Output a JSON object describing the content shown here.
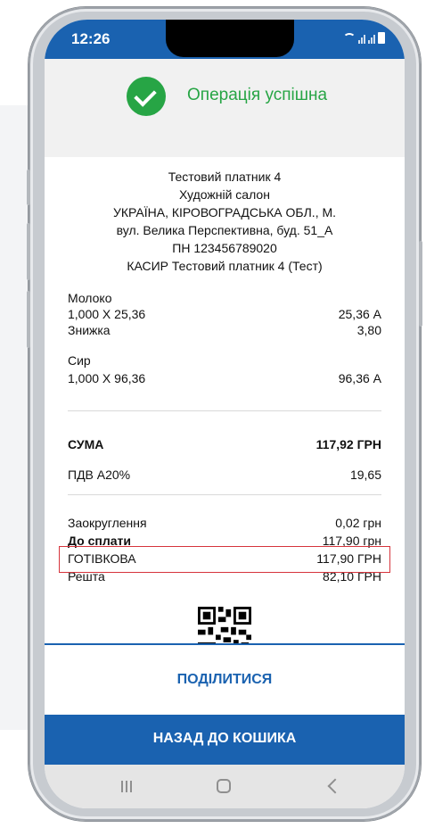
{
  "status_bar": {
    "time": "12:26"
  },
  "success": {
    "message": "Операція успішна"
  },
  "receipt": {
    "header": [
      "Тестовий платник 4",
      "Художній салон",
      "УКРАЇНА, КІРОВОГРАДСЬКА ОБЛ., М.",
      "вул. Велика Перспективна, буд. 51_А",
      "ПН 123456789020",
      "КАСИР Тестовий платник 4 (Тест)"
    ],
    "items": [
      {
        "name": "Молоко",
        "qty_line": "1,000 X 25,36",
        "amount": "25,36 А",
        "discount_label": "Знижка",
        "discount": "3,80"
      },
      {
        "name": "Сир",
        "qty_line": "1,000 X 96,36",
        "amount": "96,36 А"
      }
    ],
    "sum": {
      "label": "СУМА",
      "value": "117,92 ГРН"
    },
    "vat": {
      "label": "ПДВ А20%",
      "value": "19,65"
    },
    "rounding": {
      "label": "Заокруглення",
      "value": "0,02 грн"
    },
    "to_pay": {
      "label": "До сплати",
      "value": "117,90 грн"
    },
    "cash": {
      "label": "ГОТІВКОВА",
      "value": "117,90 ГРН"
    },
    "change": {
      "label": "Решта",
      "value": "82,10 ГРН"
    }
  },
  "actions": {
    "share_label": "ПОДІЛИТИСЯ",
    "back_label": "НАЗАД ДО КОШИКА"
  },
  "colors": {
    "primary": "#1a62b0",
    "success": "#27a545",
    "highlight": "#d6343c"
  }
}
